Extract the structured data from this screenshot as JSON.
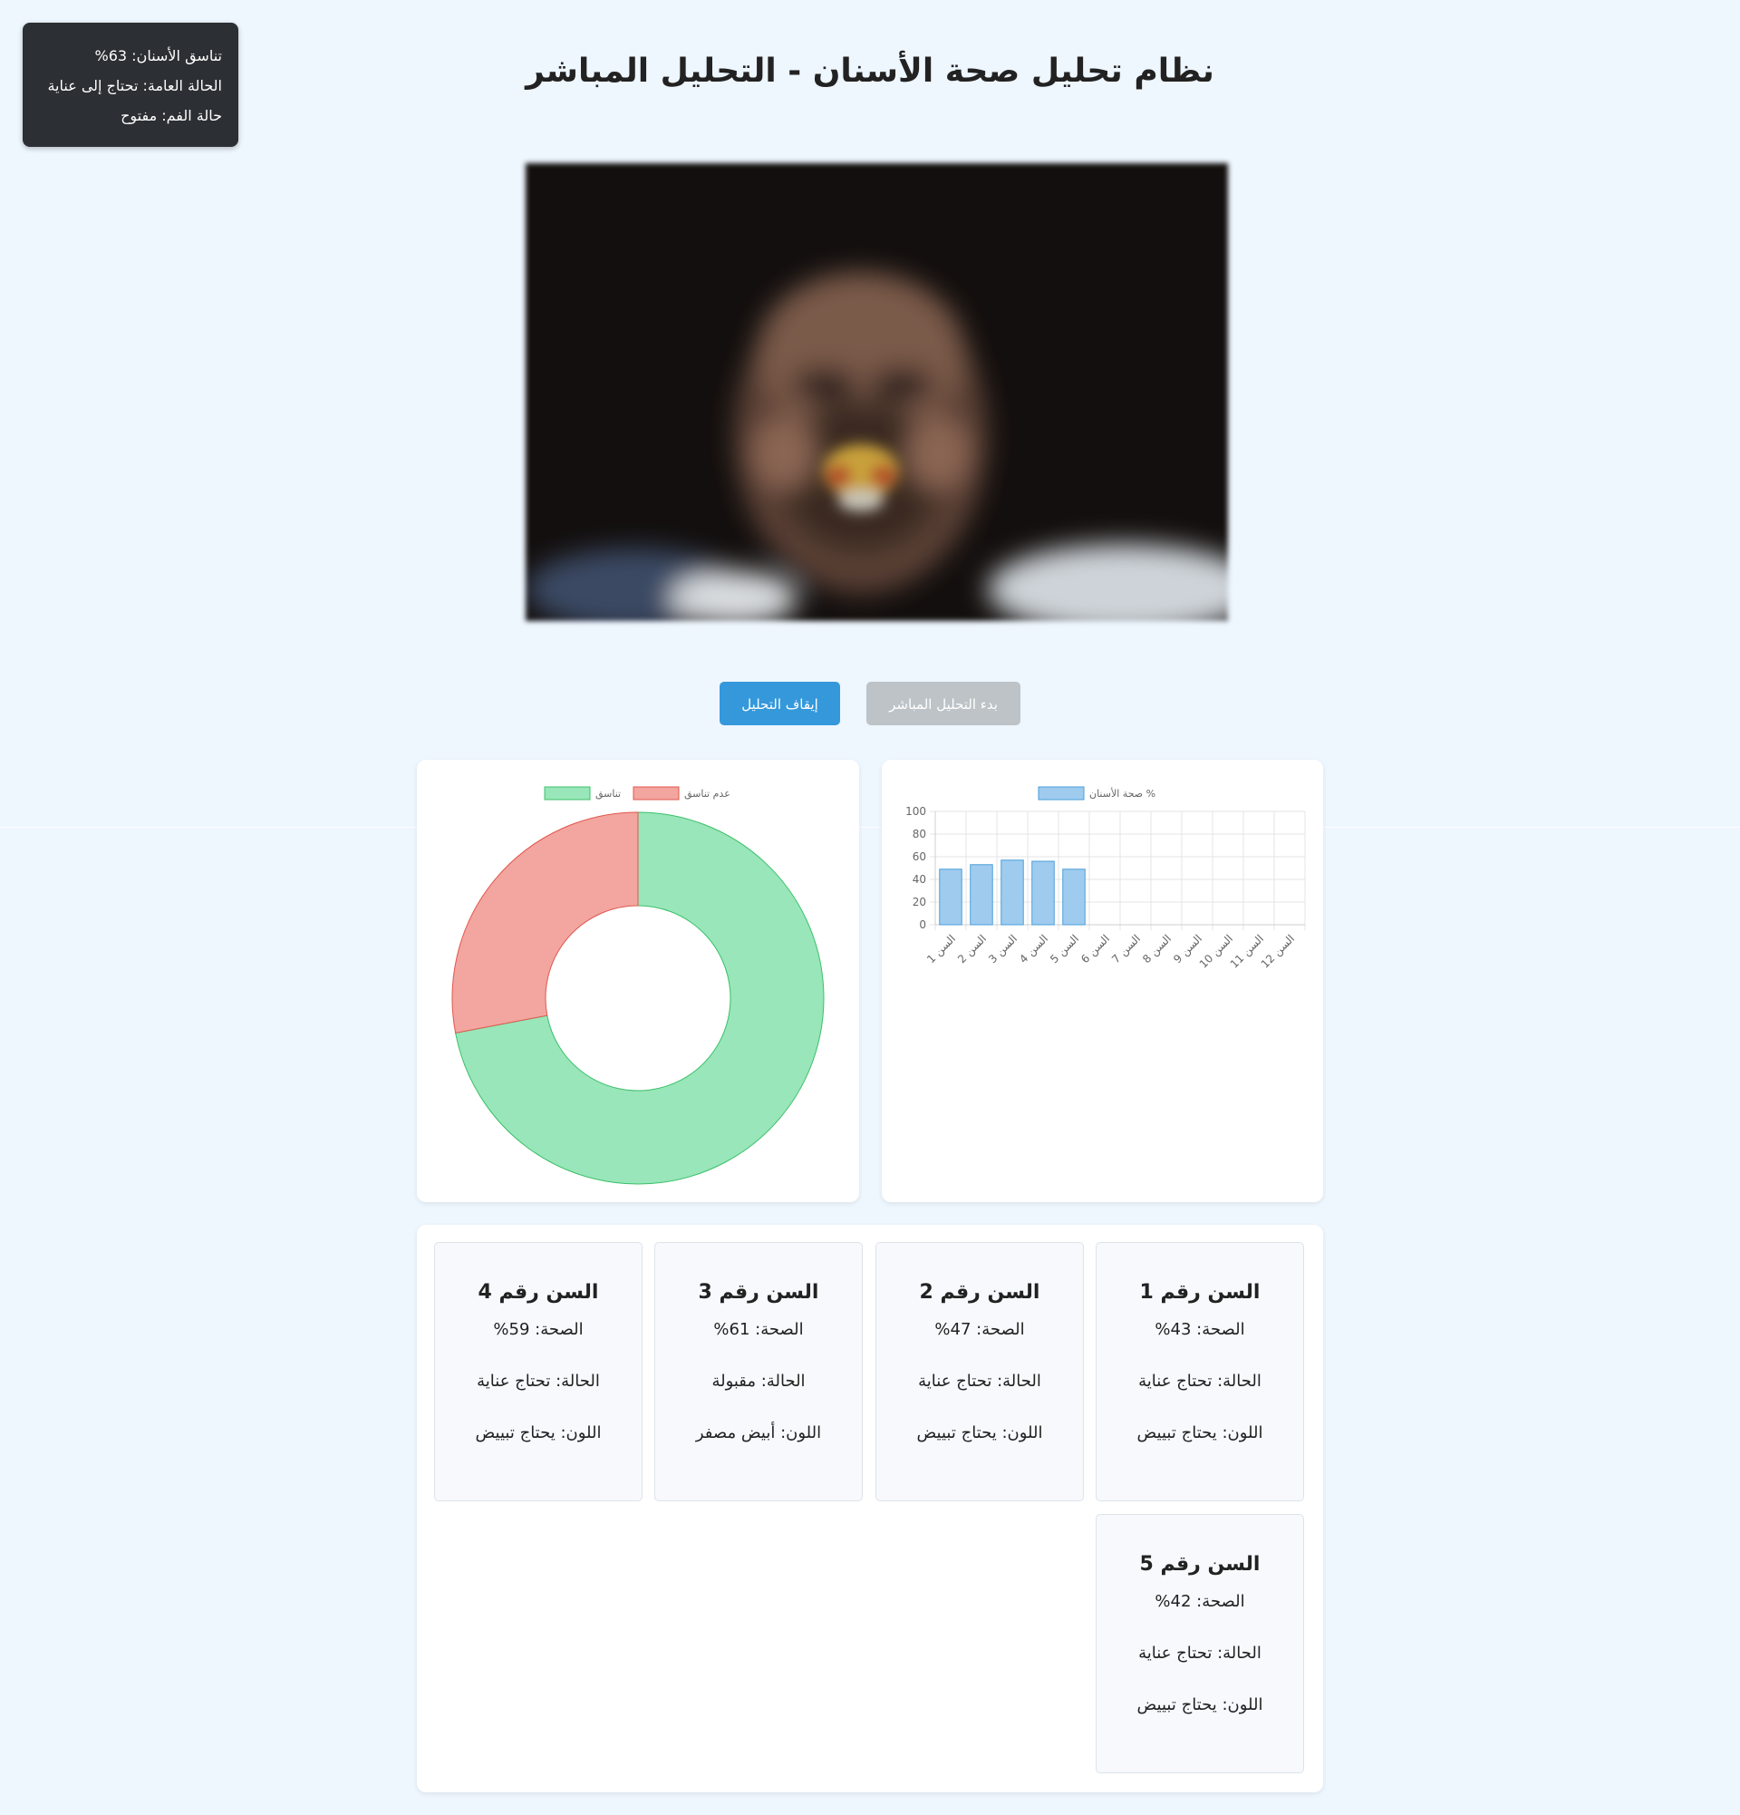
{
  "overlay": {
    "coherence": "تناسق الأسنان: 63%",
    "general_status": "الحالة العامة: تحتاج إلى عناية",
    "mouth_status": "حالة الفم: مفتوح"
  },
  "header": {
    "title": "نظام تحليل صحة الأسنان - التحليل المباشر"
  },
  "buttons": {
    "stop_label": "إيقاف التحليل",
    "start_label": "بدء التحليل المباشر"
  },
  "colors": {
    "accent": "#3498db",
    "disabled": "#bdc3c7",
    "pie_coherent": "#98e6b9",
    "pie_incoherent": "#f3a5a0",
    "bar_fill": "#9fcbef"
  },
  "chart_data": [
    {
      "type": "pie",
      "variant": "doughnut",
      "legend": [
        "تناسق",
        "عدم تناسق"
      ],
      "legend_position": "top",
      "values": [
        72,
        28
      ]
    },
    {
      "type": "bar",
      "legend": [
        "صحة الأسنان %"
      ],
      "legend_position": "top",
      "categories": [
        "السن 1",
        "السن 2",
        "السن 3",
        "السن 4",
        "السن 5",
        "السن 6",
        "السن 7",
        "السن 8",
        "السن 9",
        "السن 10",
        "السن 11",
        "السن 12"
      ],
      "values": [
        49,
        53,
        57,
        56,
        49,
        null,
        null,
        null,
        null,
        null,
        null,
        null
      ],
      "ylim": [
        0,
        100
      ],
      "yticks": [
        0,
        20,
        40,
        60,
        80,
        100
      ],
      "grid": true
    }
  ],
  "teeth": [
    {
      "title": "السن رقم 1",
      "health": "الصحة: 43%",
      "status": "الحالة: تحتاج عناية",
      "color": "اللون: يحتاج تبييض"
    },
    {
      "title": "السن رقم 2",
      "health": "الصحة: 47%",
      "status": "الحالة: تحتاج عناية",
      "color": "اللون: يحتاج تبييض"
    },
    {
      "title": "السن رقم 3",
      "health": "الصحة: 61%",
      "status": "الحالة: مقبولة",
      "color": "اللون: أبيض مصفر"
    },
    {
      "title": "السن رقم 4",
      "health": "الصحة: 59%",
      "status": "الحالة: تحتاج عناية",
      "color": "اللون: يحتاج تبييض"
    },
    {
      "title": "السن رقم 5",
      "health": "الصحة: 42%",
      "status": "الحالة: تحتاج عناية",
      "color": "اللون: يحتاج تبييض"
    }
  ]
}
